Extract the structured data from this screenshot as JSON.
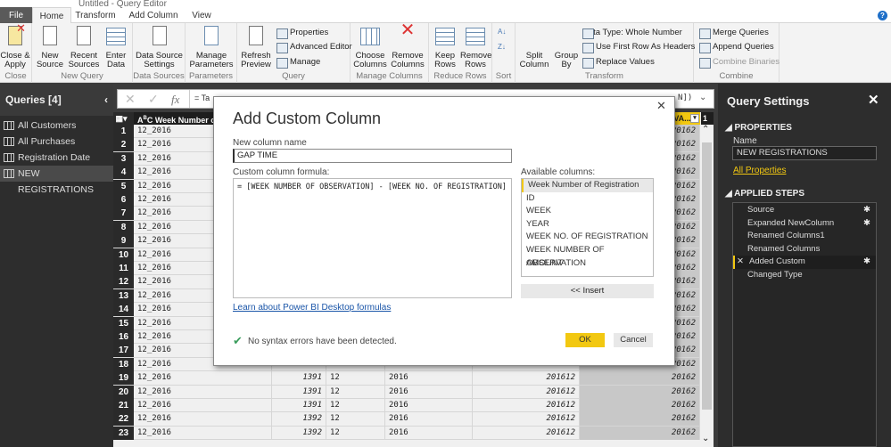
{
  "window": {
    "title": "Untitled - Query Editor"
  },
  "tabs": [
    "File",
    "Home",
    "Transform",
    "Add Column",
    "View"
  ],
  "ribbon": {
    "groups": [
      {
        "label": "Close",
        "buttons": [
          "Close & Apply"
        ]
      },
      {
        "label": "New Query",
        "buttons": [
          "New Source",
          "Recent Sources",
          "Enter Data"
        ]
      },
      {
        "label": "Data Sources",
        "buttons": [
          "Data Source Settings"
        ]
      },
      {
        "label": "Parameters",
        "buttons": [
          "Manage Parameters"
        ]
      },
      {
        "label": "Query",
        "buttons": [
          "Refresh Preview"
        ],
        "small": [
          "Properties",
          "Advanced Editor",
          "Manage"
        ]
      },
      {
        "label": "Manage Columns",
        "buttons": [
          "Choose Columns",
          "Remove Columns"
        ]
      },
      {
        "label": "Reduce Rows",
        "buttons": [
          "Keep Rows",
          "Remove Rows"
        ]
      },
      {
        "label": "Sort",
        "buttons": []
      },
      {
        "label": "Transform",
        "buttons": [
          "Split Column",
          "Group By"
        ],
        "small": [
          "Data Type: Whole Number",
          "Use First Row As Headers",
          "Replace Values"
        ]
      },
      {
        "label": "Combine",
        "small": [
          "Merge Queries",
          "Append Queries",
          "Combine Binaries"
        ]
      }
    ]
  },
  "queries": {
    "title": "Queries [4]",
    "items": [
      "All Customers",
      "All Purchases",
      "Registration Date",
      "NEW REGISTRATIONS"
    ],
    "selected": 3
  },
  "formula_bar": {
    "prefix": "= Ta",
    "suffix": "N])"
  },
  "grid": {
    "headers": [
      "Week Number of R",
      "RVA...",
      "1"
    ],
    "rows": [
      {
        "n": "1",
        "c": [
          "12_2016",
          "",
          "",
          "",
          "",
          "20162"
        ]
      },
      {
        "n": "2",
        "c": [
          "12_2016",
          "",
          "",
          "",
          "",
          "20162"
        ]
      },
      {
        "n": "3",
        "c": [
          "12_2016",
          "",
          "",
          "",
          "",
          "20162"
        ]
      },
      {
        "n": "4",
        "c": [
          "12_2016",
          "",
          "",
          "",
          "",
          "20162"
        ]
      },
      {
        "n": "5",
        "c": [
          "12_2016",
          "",
          "",
          "",
          "",
          "20162"
        ]
      },
      {
        "n": "6",
        "c": [
          "12_2016",
          "",
          "",
          "",
          "",
          "20162"
        ]
      },
      {
        "n": "7",
        "c": [
          "12_2016",
          "",
          "",
          "",
          "",
          "20162"
        ]
      },
      {
        "n": "8",
        "c": [
          "12_2016",
          "",
          "",
          "",
          "",
          "20162"
        ]
      },
      {
        "n": "9",
        "c": [
          "12_2016",
          "",
          "",
          "",
          "",
          "20162"
        ]
      },
      {
        "n": "10",
        "c": [
          "12_2016",
          "",
          "",
          "",
          "",
          "20162"
        ]
      },
      {
        "n": "11",
        "c": [
          "12_2016",
          "",
          "",
          "",
          "",
          "20162"
        ]
      },
      {
        "n": "12",
        "c": [
          "12_2016",
          "",
          "",
          "",
          "",
          "20162"
        ]
      },
      {
        "n": "13",
        "c": [
          "12_2016",
          "",
          "",
          "",
          "",
          "20162"
        ]
      },
      {
        "n": "14",
        "c": [
          "12_2016",
          "",
          "",
          "",
          "",
          "20162"
        ]
      },
      {
        "n": "15",
        "c": [
          "12_2016",
          "",
          "",
          "",
          "",
          "20162"
        ]
      },
      {
        "n": "16",
        "c": [
          "12_2016",
          "",
          "",
          "",
          "",
          "20162"
        ]
      },
      {
        "n": "17",
        "c": [
          "12_2016",
          "",
          "",
          "",
          "",
          "20162"
        ]
      },
      {
        "n": "18",
        "c": [
          "12_2016",
          "",
          "",
          "",
          "",
          "20162"
        ]
      },
      {
        "n": "19",
        "c": [
          "12_2016",
          "1391",
          "12",
          "2016",
          "201612",
          "20162"
        ]
      },
      {
        "n": "20",
        "c": [
          "12_2016",
          "1391",
          "12",
          "2016",
          "201612",
          "20162"
        ]
      },
      {
        "n": "21",
        "c": [
          "12_2016",
          "1391",
          "12",
          "2016",
          "201612",
          "20162"
        ]
      },
      {
        "n": "22",
        "c": [
          "12_2016",
          "1392",
          "12",
          "2016",
          "201612",
          "20162"
        ]
      },
      {
        "n": "23",
        "c": [
          "12_2016",
          "1392",
          "12",
          "2016",
          "201612",
          "20162"
        ]
      }
    ]
  },
  "settings": {
    "title": "Query Settings",
    "properties_label": "PROPERTIES",
    "name_label": "Name",
    "name_value": "NEW REGISTRATIONS",
    "all_properties": "All Properties",
    "applied_steps_label": "APPLIED STEPS",
    "steps": [
      {
        "label": "Source",
        "gear": true
      },
      {
        "label": "Expanded NewColumn",
        "gear": true
      },
      {
        "label": "Renamed Columns1",
        "gear": false
      },
      {
        "label": "Renamed Columns",
        "gear": false
      },
      {
        "label": "Added Custom",
        "gear": true,
        "selected": true
      },
      {
        "label": "Changed Type",
        "gear": false
      }
    ]
  },
  "dialog": {
    "title": "Add Custom Column",
    "name_label": "New column name",
    "name_value": "GAP TIME",
    "formula_label": "Custom column formula:",
    "formula_value": "= [WEEK NUMBER OF OBSERVATION] - [WEEK NO. OF REGISTRATION]",
    "available_label": "Available columns:",
    "columns": [
      "Week Number of Registration",
      "ID",
      "WEEK",
      "YEAR",
      "WEEK NO. OF REGISTRATION",
      "WEEK NUMBER OF OBSERVATION",
      "AMOUNT"
    ],
    "insert": "<< Insert",
    "learn_link": "Learn about Power BI Desktop formulas",
    "status": "No syntax errors have been detected.",
    "ok": "OK",
    "cancel": "Cancel"
  },
  "colors": {
    "accent": "#f2c811",
    "dark": "#2d2d2d",
    "ok_green": "#3a9d5d"
  }
}
